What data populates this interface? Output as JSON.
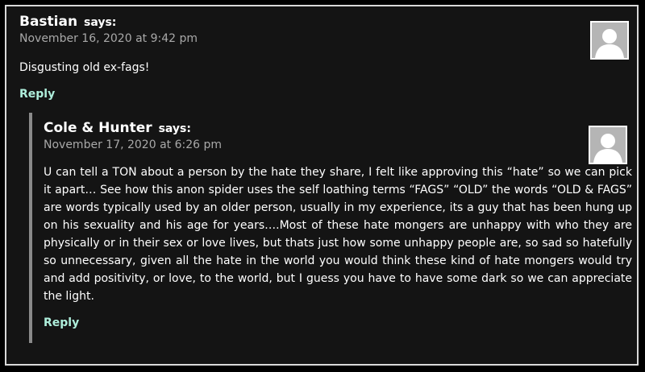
{
  "comments": [
    {
      "author": "Bastian",
      "says": "says:",
      "date": "November 16, 2020 at 9:42 pm",
      "text": "Disgusting old ex-fags!",
      "reply_label": "Reply"
    },
    {
      "author": "Cole & Hunter",
      "says": "says:",
      "date": "November 17, 2020 at 6:26 pm",
      "text": "U can tell a TON about a person by the hate they share, I felt like approving this “hate” so we can pick it apart… See how this anon spider uses the self loathing terms “FAGS” “OLD” the words “OLD & FAGS” are words typically used by an older person, usually in my experience, its a guy that has been hung up on his sexuality and his age for years….Most of these hate mongers are unhappy with who they are physically or in their sex or love lives, but thats just how some unhappy people are, so sad so hatefully so unnecessary, given all the hate in the world you would think these kind of hate mongers would try and add positivity, or love, to the world, but I guess you have to have some dark so we can appreciate the light.",
      "reply_label": "Reply"
    }
  ],
  "colors": {
    "background": "#141414",
    "reply_link": "#aeeedb",
    "meta_text": "#a9a9a9"
  },
  "icons": {
    "avatar": "default-avatar-icon"
  }
}
